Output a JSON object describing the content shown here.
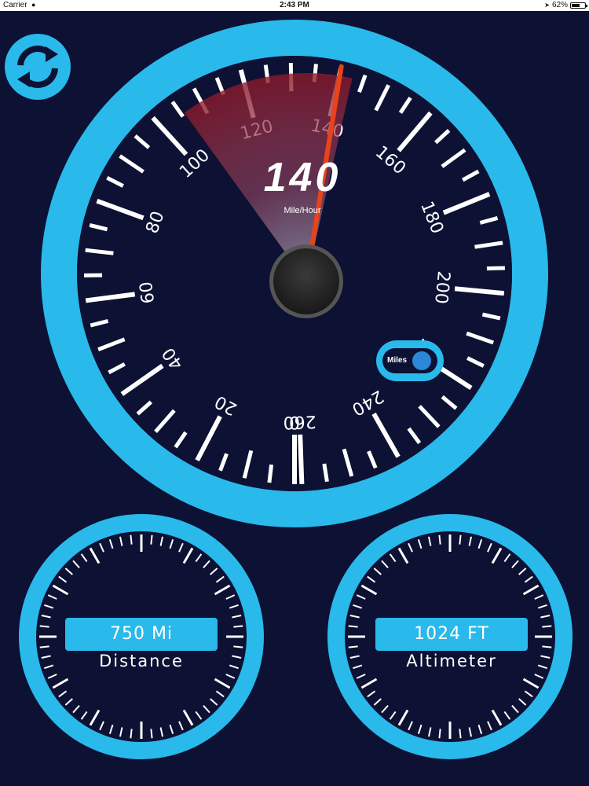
{
  "status_bar": {
    "carrier": "Carrier",
    "time": "2:43 PM",
    "battery": "62%"
  },
  "speedometer": {
    "value": 140,
    "value_label": "140",
    "unit_label": "Mile/Hour",
    "min": 0,
    "max": 260,
    "tick_labels": [
      "0",
      "20",
      "40",
      "60",
      "80",
      "100",
      "120",
      "140",
      "160",
      "180",
      "200",
      "220",
      "240",
      "260"
    ],
    "toggle_label": "Miles",
    "colors": {
      "ring": "#29b9eb",
      "face": "#0d1133",
      "needle": "#e8431a",
      "sweep": "#8b1a2b"
    }
  },
  "distance": {
    "value": "750 Mi",
    "label": "Distance"
  },
  "altimeter": {
    "value": "1024 FT",
    "label": "Altimeter"
  },
  "icons": {
    "refresh": "refresh-icon"
  }
}
